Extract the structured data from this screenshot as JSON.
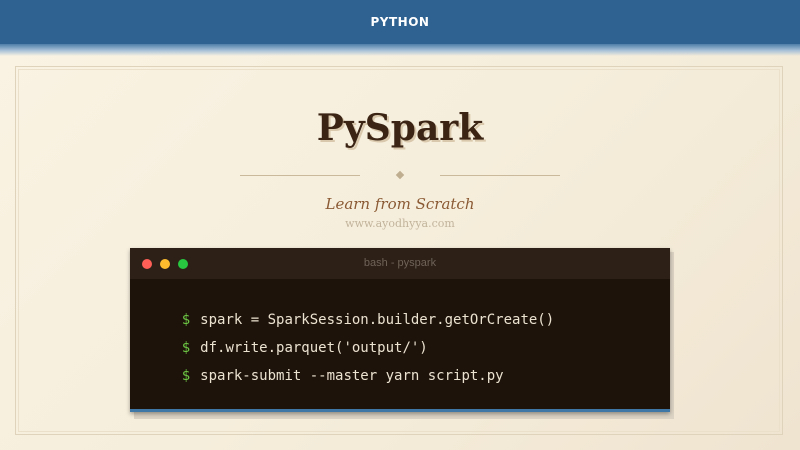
{
  "header": {
    "title": "PYTHON",
    "color": "#2f6291"
  },
  "hero": {
    "title": "PySpark",
    "subtitle": "Learn from Scratch",
    "website": "www.ayodhyya.com"
  },
  "terminal": {
    "window_title": "bash - pyspark",
    "buttons": [
      "close",
      "minimize",
      "maximize"
    ],
    "prompt_symbol": "$",
    "commands": [
      "spark = SparkSession.builder.getOrCreate()",
      "df.write.parquet('output/')",
      "spark-submit --master yarn script.py"
    ]
  },
  "colors": {
    "background": "#f6eedc",
    "title": "#3b2414",
    "subtitle": "#8a5a34",
    "terminal_bg": "#1e130b",
    "prompt": "#6cc644"
  }
}
